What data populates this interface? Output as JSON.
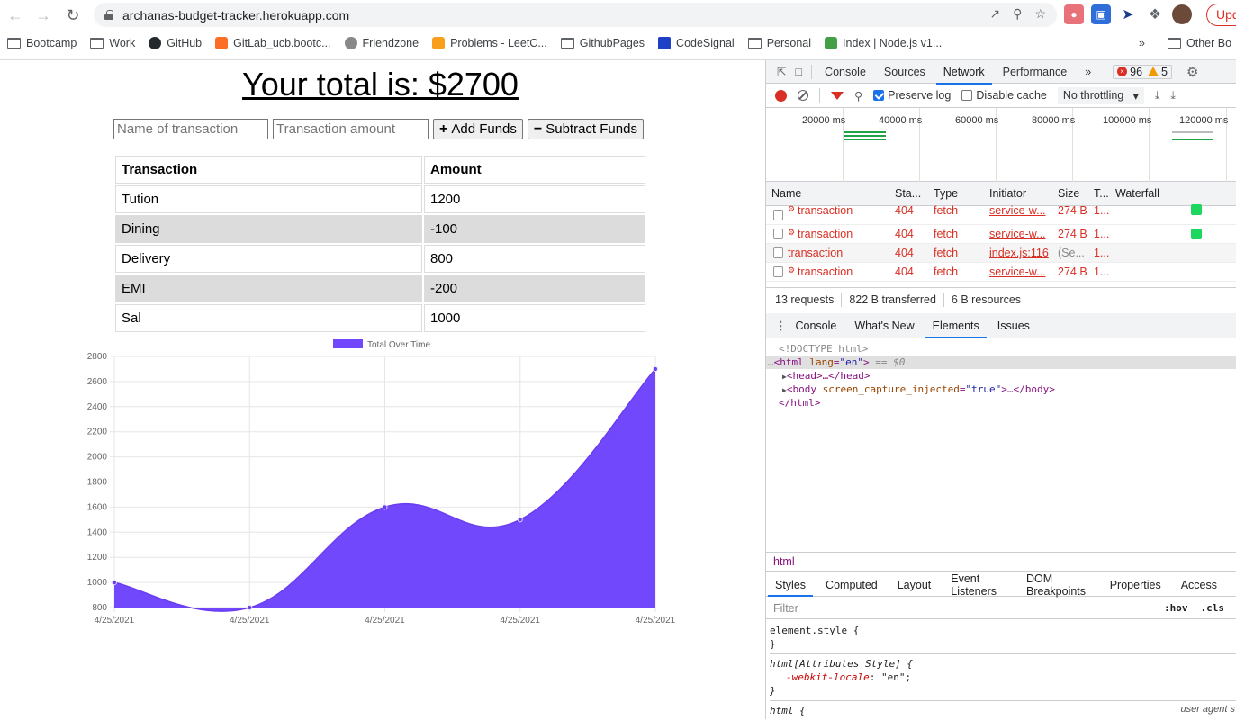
{
  "browser": {
    "url": "archanas-budget-tracker.herokuapp.com",
    "update_label": "Upd",
    "bookmarks": [
      "Bootcamp",
      "Work",
      "GitHub",
      "GitLab_ucb.bootc...",
      "Friendzone",
      "Problems - LeetC...",
      "GithubPages",
      "CodeSignal",
      "Personal",
      "Index | Node.js v1..."
    ],
    "more": "»",
    "other_bookmarks": "Other Bo"
  },
  "page": {
    "total_text": "Your total is: $2700",
    "name_placeholder": "Name of transaction",
    "amount_placeholder": "Transaction amount",
    "add_label": "Add Funds",
    "subtract_label": "Subtract Funds",
    "table_headers": [
      "Transaction",
      "Amount"
    ],
    "rows": [
      {
        "name": "Tution",
        "amount": "1200"
      },
      {
        "name": "Dining",
        "amount": "-100"
      },
      {
        "name": "Delivery",
        "amount": "800"
      },
      {
        "name": "EMI",
        "amount": "-200"
      },
      {
        "name": "Sal",
        "amount": "1000"
      }
    ]
  },
  "chart_data": {
    "type": "area",
    "x": [
      "4/25/2021",
      "4/25/2021",
      "4/25/2021",
      "4/25/2021",
      "4/25/2021"
    ],
    "series": [
      {
        "name": "Total Over Time",
        "values": [
          1000,
          800,
          1600,
          1500,
          2700
        ],
        "color": "#7148fc"
      }
    ],
    "ylim": [
      800,
      2800
    ],
    "yticks": [
      800,
      1000,
      1200,
      1400,
      1600,
      1800,
      2000,
      2200,
      2400,
      2600,
      2800
    ],
    "grid": true,
    "legend": "top"
  },
  "devtools": {
    "tabs": [
      "Console",
      "Sources",
      "Network",
      "Performance",
      "»"
    ],
    "active_tab": "Network",
    "error_count": "96",
    "warning_count": "5",
    "preserve_log": "Preserve log",
    "disable_cache": "Disable cache",
    "throttling": "No throttling",
    "timeline_labels": [
      "20000 ms",
      "40000 ms",
      "60000 ms",
      "80000 ms",
      "100000 ms",
      "120000 ms"
    ],
    "columns": [
      "Name",
      "Sta...",
      "Type",
      "Initiator",
      "Size",
      "T...",
      "Waterfall"
    ],
    "requests": [
      {
        "name": "transaction",
        "status": "404",
        "type": "fetch",
        "initiator": "service-w...",
        "size": "274 B",
        "time": "1...",
        "gear": true
      },
      {
        "name": "transaction",
        "status": "404",
        "type": "fetch",
        "initiator": "service-w...",
        "size": "274 B",
        "time": "1...",
        "gear": true
      },
      {
        "name": "transaction",
        "status": "404",
        "type": "fetch",
        "initiator": "index.js:116",
        "size": "(Se...",
        "time": "1...",
        "gear": false
      },
      {
        "name": "transaction",
        "status": "404",
        "type": "fetch",
        "initiator": "service-w...",
        "size": "274 B",
        "time": "1...",
        "gear": true
      }
    ],
    "summary": [
      "13 requests",
      "822 B transferred",
      "6 B resources"
    ],
    "drawer_tabs": [
      "Console",
      "What's New",
      "Elements",
      "Issues"
    ],
    "breadcrumb": "html",
    "style_tabs": [
      "Styles",
      "Computed",
      "Layout",
      "Event Listeners",
      "DOM Breakpoints",
      "Properties",
      "Access"
    ],
    "filter_placeholder": "Filter",
    "hov": ":hov",
    "cls": ".cls",
    "dom": {
      "doctype": "<!DOCTYPE html>",
      "html_open": "<html",
      "lang_attr": "lang",
      "lang_val": "\"en\"",
      "close_gt": ">",
      "eq": " == $0",
      "head": "<head>…</head>",
      "body_open": "<body",
      "body_attr": "screen_capture_injected",
      "body_val": "\"true\"",
      "body_close": ">…</body>",
      "html_close": "</html>"
    },
    "rules": {
      "element_style": "element.style {",
      "brace_close": "}",
      "attr_style": "html[Attributes Style] {",
      "locale_prop": "-webkit-locale",
      "locale_val": ": \"en\";",
      "html_rule": "html {",
      "ua": "user agent s"
    }
  }
}
